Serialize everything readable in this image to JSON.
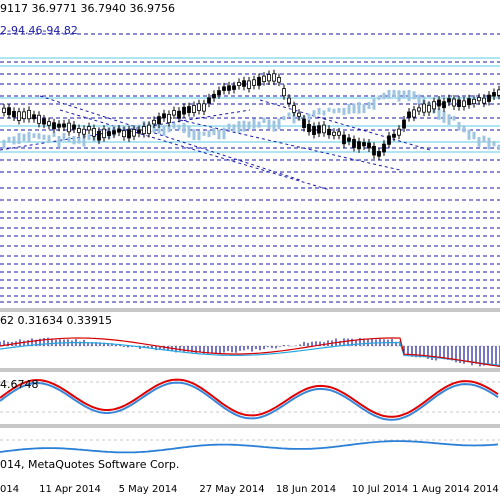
{
  "main_chart": {
    "ohlc_text": "9117 36.9771 36.7940 36.9756",
    "fib_text": "2-94.46-94.82"
  },
  "macd": {
    "values_text": "62 0.31634 0.33915"
  },
  "stochastic": {
    "values_text": "4.6748"
  },
  "rsi": {
    "copyright_text": "014, MetaQuotes Software Corp."
  },
  "x_axis": {
    "labels": [
      "014",
      "11 Apr 2014",
      "5 May 2014",
      "27 May 2014",
      "18 Jun 2014",
      "10 Jul 2014",
      "1 Aug 2014",
      "2014"
    ]
  },
  "colors": {
    "fib_lines": "#1a1aa8",
    "candles": "#000000",
    "shadow_candles": "#9fc4e0",
    "cyan_lines": "#7fd4ea",
    "macd_hist": "#1a1aa8",
    "macd_red": "#d40000",
    "macd_blue": "#27a7e0",
    "stoch_red": "#e00000",
    "stoch_blue": "#3a86d6",
    "rsi_line": "#2a7fd6"
  }
}
